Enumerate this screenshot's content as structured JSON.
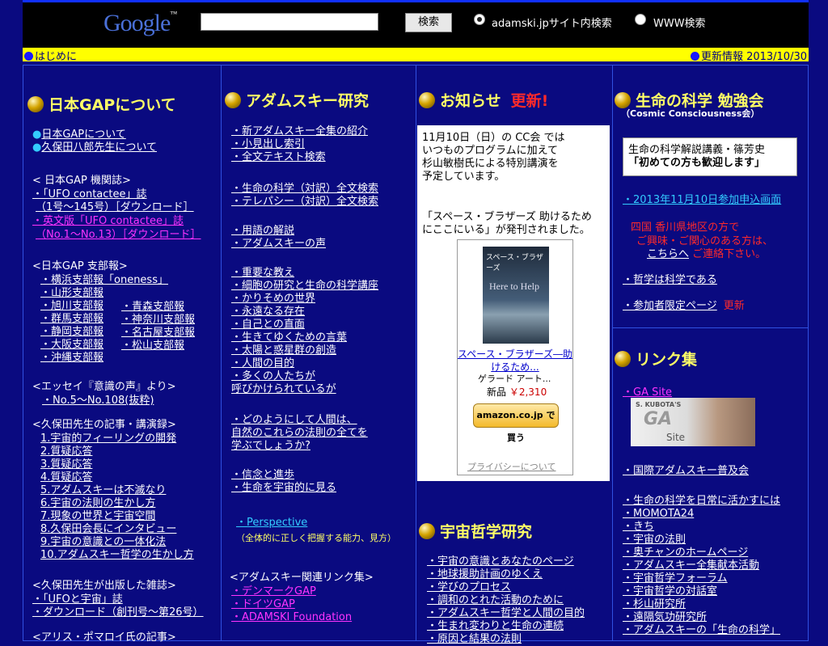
{
  "search": {
    "logo_text": "Google",
    "logo_tm": "™",
    "button": "検索",
    "option_site": "adamski.jpサイト内検索",
    "option_www": "WWW検索"
  },
  "topbar": {
    "left": "はじめに",
    "right": "更新情報  2013/10/30"
  },
  "col1": {
    "heading": "日本GAPについて",
    "links_a": [
      "日本GAPについて",
      "久保田八郎先生について"
    ],
    "organ_heading": "< 日本GAP 機関誌>",
    "organ_1": "・「UFO contactee」誌",
    "organ_1b": "（1号～145号）［ダウンロード］",
    "organ_2": "・英文版「UFO contactee」誌",
    "organ_2b": "（No.1～No.13）［ダウンロード］",
    "branch_heading": "<日本GAP 支部報>",
    "branch_left": [
      "・横浜支部報「oneness」",
      "・山形支部報",
      "・旭川支部報",
      "・群馬支部報",
      "・静岡支部報",
      "・大阪支部報",
      "・沖縄支部報"
    ],
    "branch_right": [
      "・青森支部報",
      "・神奈川支部報",
      "・名古屋支部報",
      "・松山支部報"
    ],
    "essay_heading": "<エッセイ『意識の声』より>",
    "essay_item": "・No.5～No.108(抜粋)",
    "articles_heading": "<久保田先生の記事・講演録>",
    "articles": [
      "1.宇宙的フィーリングの開発",
      "2.質疑応答",
      "3.質疑応答",
      "4.質疑応答",
      "5.アダムスキーは不滅なり",
      "6.宇宙の法則の生かし方",
      "7.現象の世界と宇宙空間",
      "8.久保田会長にインタビュー",
      "9.宇宙の意識との一体化法",
      "10.アダムスキー哲学の生かし方"
    ],
    "mag_heading": "<久保田先生が出版した雑誌>",
    "mag_1": "・「UFOと宇宙」誌",
    "mag_2": "・ダウンロード（創刊号～第26号）",
    "alice_heading": "<アリス・ポマロイ氏の記事>"
  },
  "col2": {
    "heading": "アダムスキー研究",
    "group1": [
      "・新アダムスキー全集の紹介",
      "・小見出し索引",
      "・全文テキスト検索"
    ],
    "group2": [
      "・生命の科学（対訳）全文検索",
      "・テレパシー（対訳）全文検索"
    ],
    "group3": [
      "・用語の解説",
      "・アダムスキーの声"
    ],
    "group4": [
      "・重要な教え",
      "・細胞の研究と生命の科学講座",
      "・かりそめの世界",
      "・永遠なる存在",
      "・自己との直面",
      "・生きてゆくための言葉",
      "・太陽と惑星群の創造",
      "・人間の目的",
      "・多くの人たちが",
      "呼びかけられているが"
    ],
    "group5": [
      "・どのようにして人間は、",
      "自然のこれらの法則の全てを",
      "学ぶでしょうか?"
    ],
    "group6": [
      "・信念と進歩",
      "・生命を宇宙的に見る"
    ],
    "perspective": "・Perspective",
    "perspective_note": "（全体的に正しく把握する能力、見方）",
    "links_heading": "<アダムスキー関連リンク集>",
    "links": [
      "・デンマークGAP",
      "・ドイツGAP",
      "・ADAMSKI Foundation"
    ]
  },
  "col3": {
    "heading": "お知らせ",
    "new_badge": "更新!",
    "notice_lines": [
      "11月10日（日）の CC会 では",
      "いつものプログラムに加えて",
      "杉山敏樹氏による特別講演を",
      "予定しています。"
    ],
    "notice2_lines": [
      "「スペース・ブラザーズ 助けるため",
      "にここにいる」が発刊されました。"
    ],
    "book_cover_title": "スペース・ブラザーズ",
    "book_cover_sub": "Here to Help",
    "book_link_1": "スペース・ブラザーズ―助",
    "book_link_2": "けるため...",
    "book_author": "ゲラード アート...",
    "book_price_label": "新品",
    "book_price": "￥2,310",
    "amazon_btn": "amazon.co.jp で買う",
    "privacy": "プライバシーについて",
    "heading2": "宇宙哲学研究",
    "phil_links": [
      "・宇宙の意識とあなたのページ",
      "・地球援助計画のゆくえ",
      "・学びのプロセス",
      "・調和のとれた活動のために",
      "・アダムスキー哲学と人間の目的",
      "・生まれ変わりと生命の連続",
      "・原因と結果の法則"
    ]
  },
  "col4": {
    "heading": "生命の科学 勉強会",
    "subheading": "（Cosmic Consciousness会）",
    "box_line1": "生命の科学解説講義・篠芳史",
    "box_line2": "「初めての方も歓迎します」",
    "signup": "・2013年11月10日参加申込画面",
    "region_1": "四国  香川県地区の方で",
    "region_2": "ご興味・ご関心のある方は、",
    "region_3a": "こちらへ",
    "region_3b": " ご連絡下さい。",
    "philosophy": "・哲学は科学である",
    "members": "・参加者限定ページ",
    "members_new": "更新",
    "links_heading": "リンク集",
    "ga_site": "・GA Site",
    "ga_img_text1": "S. KUBOTA'S",
    "ga_img_text2": "GA",
    "ga_img_text3": "Site",
    "intl": "・国際アダムスキー普及会",
    "links": [
      "・生命の科学を日常に活かすには",
      "・MOMOTA24",
      "・きち",
      "・宇宙の法則",
      "・奥チャンのホームページ",
      "・アダムスキー全集献本活動",
      "・宇宙哲学フォーラム",
      "・宇宙哲学の対話室",
      "・杉山研究所",
      "・遠隔気功研究所",
      "・アダムスキーの「生命の科学」"
    ]
  }
}
